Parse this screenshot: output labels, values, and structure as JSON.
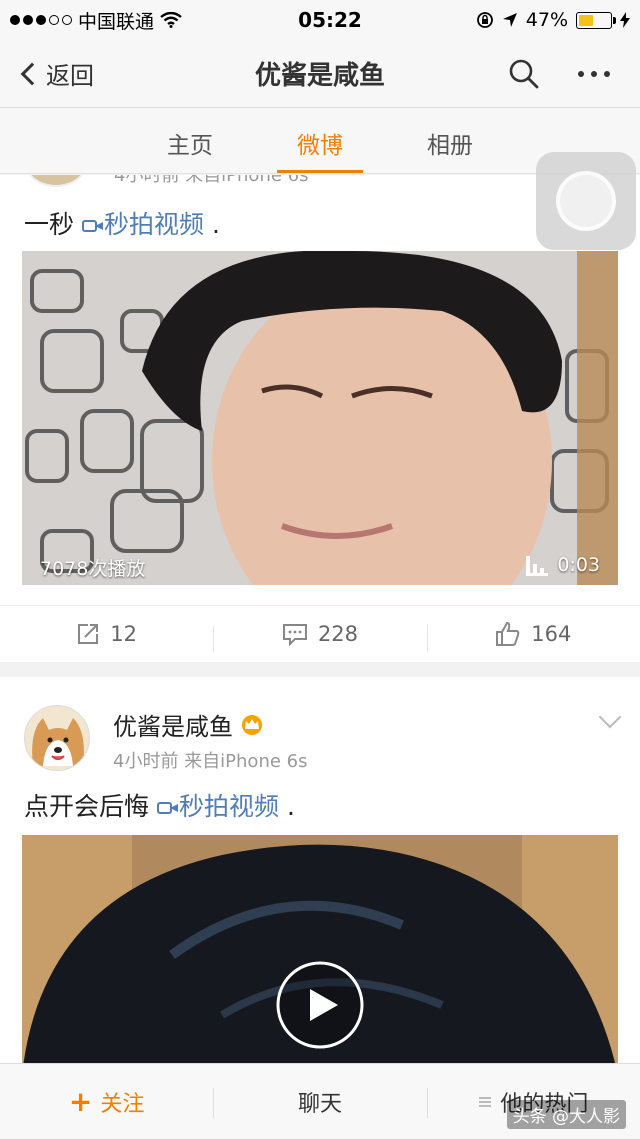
{
  "status_bar": {
    "carrier": "中国联通",
    "time": "05:22",
    "battery": "47%",
    "battery_level": 0.47
  },
  "nav": {
    "back_label": "返回",
    "title": "优酱是咸鱼"
  },
  "tabs": [
    {
      "label": "主页"
    },
    {
      "label": "微博"
    },
    {
      "label": "相册"
    }
  ],
  "post1": {
    "meta": "4小时前  来自iPhone 6s",
    "text": "一秒",
    "link": "秒拍视频",
    "trail": ".",
    "play_count": "7078次播放",
    "duration": "0:03",
    "reposts": "12",
    "comments": "228",
    "likes": "164"
  },
  "post2": {
    "author": "优酱是咸鱼",
    "meta": "4小时前  来自iPhone 6s",
    "text": "点开会后悔",
    "link": "秒拍视频",
    "trail": "."
  },
  "bottom": {
    "follow": "关注",
    "chat": "聊天",
    "hot": "他的热门"
  },
  "watermark": "头条 @大人影",
  "colors": {
    "accent": "#f18000",
    "link": "#4f7db8"
  }
}
